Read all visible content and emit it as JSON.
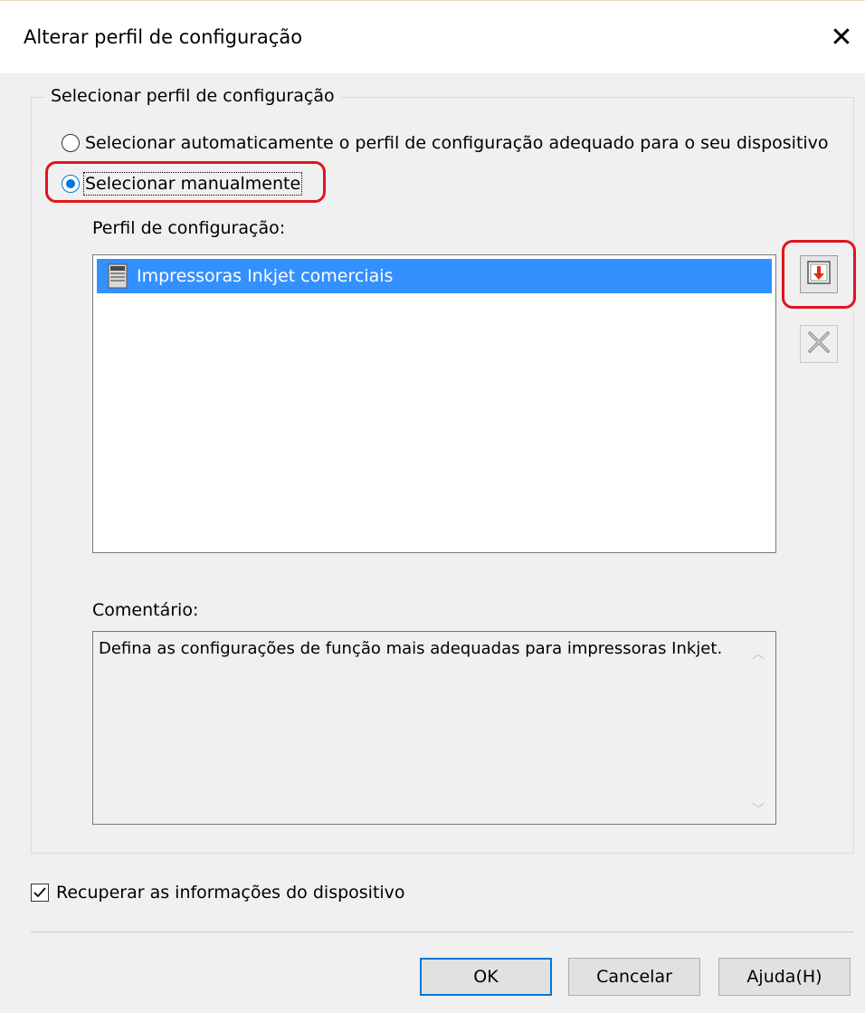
{
  "window": {
    "title": "Alterar perfil de configuração",
    "close_label": "✕"
  },
  "group": {
    "legend": "Selecionar perfil de configuração",
    "radio_auto": {
      "label": "Selecionar automaticamente o perfil de configuração adequado para o seu dispositivo",
      "checked": false
    },
    "radio_manual": {
      "label": "Selecionar manualmente",
      "checked": true
    },
    "profile_label": "Perfil de configuração:",
    "profiles": [
      {
        "label": "Impressoras Inkjet comerciais",
        "selected": true,
        "icon": "printer-icon"
      }
    ],
    "import_icon": "import-profile-icon",
    "delete_icon": "delete-profile-icon",
    "comment_label": "Comentário:",
    "comment_text": "Defina as configurações de função mais adequadas para impressoras Inkjet."
  },
  "retrieve_checkbox": {
    "label": "Recuperar as informações do dispositivo",
    "checked": true
  },
  "buttons": {
    "ok": "OK",
    "cancel": "Cancelar",
    "help": "Ajuda(H)"
  },
  "colors": {
    "selection": "#3390ff",
    "highlight_annotation": "#e0141e",
    "accent": "#0078d7"
  }
}
